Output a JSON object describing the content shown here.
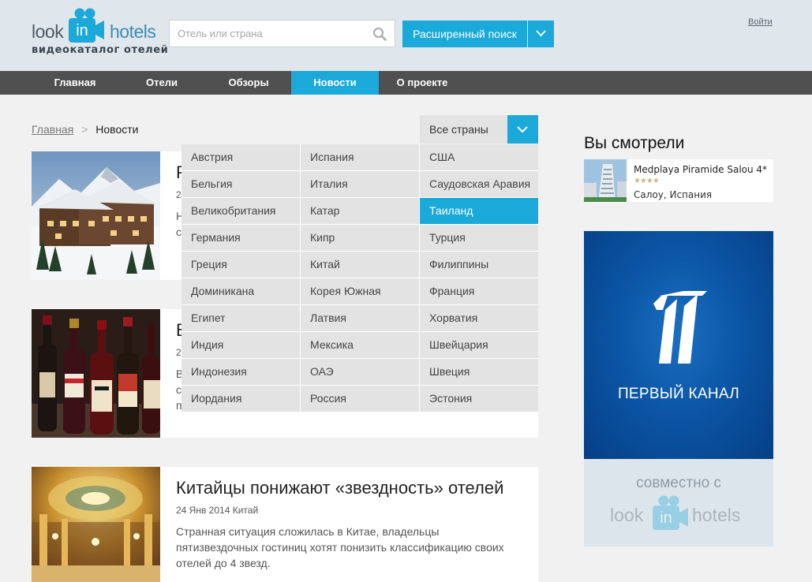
{
  "logo": {
    "word_left": "look",
    "word_mid": "in",
    "word_right": "hotels",
    "subtitle": "видеокаталог отелей"
  },
  "search": {
    "placeholder": "Отель или страна",
    "value": ""
  },
  "advanced_search": {
    "label": "Расширенный поиск"
  },
  "login": {
    "label": "Войти"
  },
  "nav": {
    "items": [
      {
        "label": "Главная",
        "active": false
      },
      {
        "label": "Отели",
        "active": false
      },
      {
        "label": "Обзоры",
        "active": false
      },
      {
        "label": "Новости",
        "active": true
      },
      {
        "label": "О проекте",
        "active": false
      }
    ]
  },
  "breadcrumb": {
    "home": "Главная",
    "separator": ">",
    "current": "Новости"
  },
  "country_filter": {
    "selected_label": "Все страны",
    "options": [
      [
        "Австрия",
        "Испания",
        "США"
      ],
      [
        "Бельгия",
        "Италия",
        "Саудовская Аравия"
      ],
      [
        "Великобритания",
        "Катар",
        "Таиланд"
      ],
      [
        "Германия",
        "Кипр",
        "Турция"
      ],
      [
        "Греция",
        "Китай",
        "Филиппины"
      ],
      [
        "Доминикана",
        "Корея Южная",
        "Франция"
      ],
      [
        "Египет",
        "Латвия",
        "Хорватия"
      ],
      [
        "Индия",
        "Мексика",
        "Швейцария"
      ],
      [
        "Индонезия",
        "ОАЭ",
        "Швеция"
      ],
      [
        "Иордания",
        "Россия",
        "Эстония"
      ]
    ],
    "highlighted": "Таиланд"
  },
  "articles": [
    {
      "title": "Р",
      "meta": "2",
      "text": [
        "Н",
        "с"
      ]
    },
    {
      "title": "В",
      "meta": "2",
      "text": [
        "В",
        "с",
        "п"
      ]
    },
    {
      "title": "Китайцы понижают «звездность» отелей",
      "meta": "24 Янв 2014 Китай",
      "text": [
        "Странная ситуация сложилась в Китае, владельцы",
        "пятизвездочных гостиниц хотят понизить классификацию своих",
        "отелей до 4 звезд."
      ]
    }
  ],
  "recently_viewed": {
    "title": "Вы смотрели",
    "item": {
      "name": "Medplaya Piramide Salou 4*",
      "stars": 4,
      "stars_text": "★★★★",
      "location": "Салоу, Испания"
    }
  },
  "ad": {
    "channel": "ПЕРВЫЙ КАНАЛ",
    "with_text": "совместно с",
    "partner_left": "look",
    "partner_mid": "in",
    "partner_right": "hotels"
  },
  "colors": {
    "accent": "#1aa9d8",
    "nav_bg": "#505050",
    "header_bg": "#dfe6ec",
    "page_bg": "#f1f1f1",
    "dropdown_cell": "#e3e3e3"
  }
}
